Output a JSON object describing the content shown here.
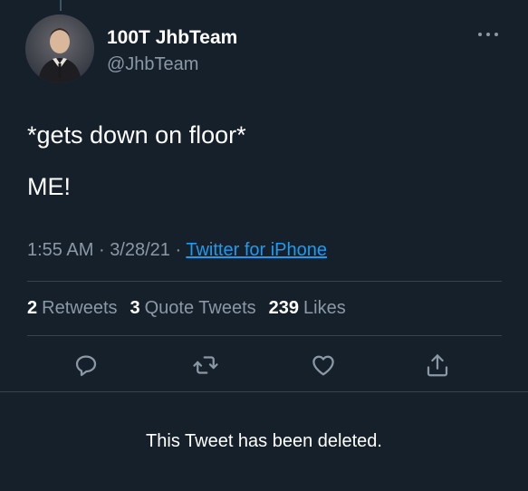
{
  "tweet": {
    "display_name": "100T JhbTeam",
    "handle": "@JhbTeam",
    "text_line1": "*gets down on floor*",
    "text_line2": "ME!",
    "time": "1:55 AM",
    "date": "3/28/21",
    "separator": "·",
    "source": "Twitter for iPhone",
    "avatar_icon": "profile-photo"
  },
  "stats": {
    "retweets_count": "2",
    "retweets_label": "Retweets",
    "quotes_count": "3",
    "quotes_label": "Quote Tweets",
    "likes_count": "239",
    "likes_label": "Likes"
  },
  "actions": {
    "icons": [
      "reply-icon",
      "retweet-icon",
      "like-icon",
      "share-icon"
    ]
  },
  "banner": {
    "message": "This Tweet has been deleted."
  },
  "colors": {
    "background": "#15202b",
    "secondary_text": "#8b98a5",
    "link": "#1d9bf0",
    "divider": "#38444d"
  }
}
